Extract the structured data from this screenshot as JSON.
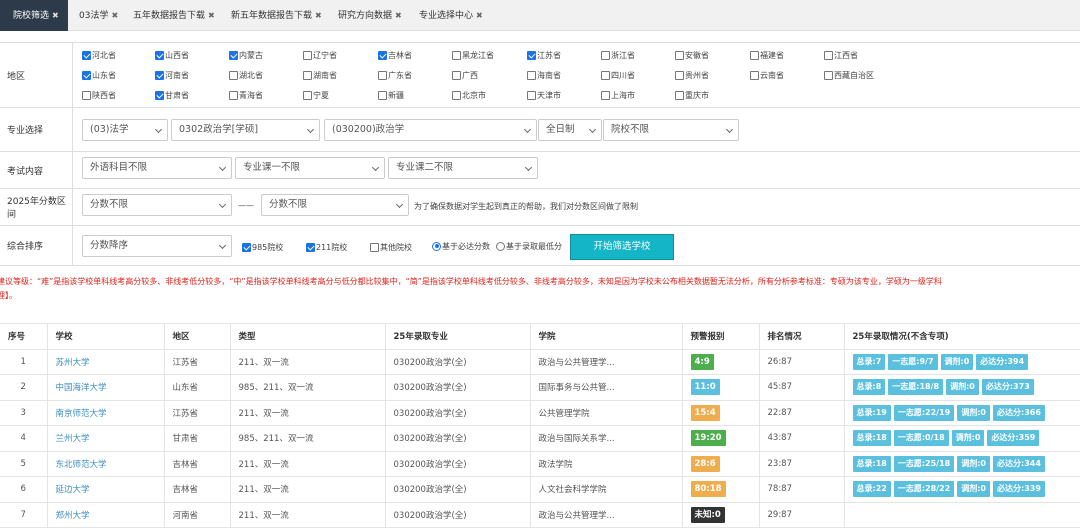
{
  "tabs": [
    {
      "label": "院校筛选",
      "active": true
    },
    {
      "label": "03法学",
      "active": false
    },
    {
      "label": "五年数据报告下载",
      "active": false
    },
    {
      "label": "新五年数据报告下载",
      "active": false
    },
    {
      "label": "研究方向数据",
      "active": false
    },
    {
      "label": "专业选择中心",
      "active": false
    }
  ],
  "region": {
    "label": "地区",
    "provinces": [
      {
        "name": "河北省",
        "checked": true
      },
      {
        "name": "山西省",
        "checked": true
      },
      {
        "name": "内蒙古",
        "checked": true
      },
      {
        "name": "辽宁省",
        "checked": false
      },
      {
        "name": "吉林省",
        "checked": true
      },
      {
        "name": "黑龙江省",
        "checked": false
      },
      {
        "name": "江苏省",
        "checked": true
      },
      {
        "name": "浙江省",
        "checked": false
      },
      {
        "name": "安徽省",
        "checked": false
      },
      {
        "name": "福建省",
        "checked": false
      },
      {
        "name": "江西省",
        "checked": false
      },
      {
        "name": "山东省",
        "checked": true
      },
      {
        "name": "河南省",
        "checked": true
      },
      {
        "name": "湖北省",
        "checked": false
      },
      {
        "name": "湖南省",
        "checked": false
      },
      {
        "name": "广东省",
        "checked": false
      },
      {
        "name": "广西",
        "checked": false
      },
      {
        "name": "海南省",
        "checked": false
      },
      {
        "name": "四川省",
        "checked": false
      },
      {
        "name": "贵州省",
        "checked": false
      },
      {
        "name": "云南省",
        "checked": false
      },
      {
        "name": "西藏自治区",
        "checked": false
      },
      {
        "name": "陕西省",
        "checked": false
      },
      {
        "name": "甘肃省",
        "checked": true
      },
      {
        "name": "青海省",
        "checked": false
      },
      {
        "name": "宁夏",
        "checked": false
      },
      {
        "name": "新疆",
        "checked": false
      },
      {
        "name": "北京市",
        "checked": false
      },
      {
        "name": "天津市",
        "checked": false
      },
      {
        "name": "上海市",
        "checked": false
      },
      {
        "name": "重庆市",
        "checked": false
      }
    ]
  },
  "major": {
    "label": "专业选择",
    "category": "(03)法学",
    "discipline": "0302政治学[学硕]",
    "major": "(030200)政治学",
    "mode": "全日制",
    "school_filter": "院校不限"
  },
  "exam": {
    "label": "考试内容",
    "foreign": "外语科目不限",
    "course1": "专业课一不限",
    "course2": "专业课二不限"
  },
  "score": {
    "label": "2025年分数区间",
    "low": "分数不限",
    "dash": "——",
    "high": "分数不限",
    "note": "为了确保数据对学生起到真正的帮助，我们对分数区间做了限制"
  },
  "sort": {
    "label": "综合排序",
    "order": "分数降序",
    "opt985": "985院校",
    "opt211": "211院校",
    "optOther": "其他院校",
    "radio1": "基于必达分数",
    "radio2": "基于录取最低分",
    "button": "开始筛选学校"
  },
  "advice": {
    "line1": "建议等级：“难”是指该学校单科线考高分较多、非线考低分较多，“中”是指该学校单科线考高分与低分都比较集中，“简”是指该学校单科线考低分较多、非线考高分较多，未知是因为学校未公布相关数据暂无法分析，所有分析参考标准：专硕为该专业，学硕为一级学科",
    "line2": "理】。"
  },
  "table": {
    "headers": [
      "序号",
      "学校",
      "地区",
      "类型",
      "25年录取专业",
      "学院",
      "预警报别",
      "排名情况",
      "25年录取情况(不含专项)"
    ],
    "rows": [
      {
        "idx": "1",
        "school": "苏州大学",
        "region": "江苏省",
        "type": "211、双一流",
        "major": "030200政治学(全)",
        "college": "政治与公共管理学...",
        "warn": "4:9",
        "warnColor": "#4cae4c",
        "rank": "26:87",
        "tags": [
          "总录:7",
          "一志愿:9/7",
          "调剂:0",
          "必达分:394"
        ]
      },
      {
        "idx": "2",
        "school": "中国海洋大学",
        "region": "山东省",
        "type": "985、211、双一流",
        "major": "030200政治学(全)",
        "college": "国际事务与公共管...",
        "warn": "11:0",
        "warnColor": "#5bc0de",
        "rank": "45:87",
        "tags": [
          "总录:8",
          "一志愿:18/8",
          "调剂:0",
          "必达分:373"
        ]
      },
      {
        "idx": "3",
        "school": "南京师范大学",
        "region": "江苏省",
        "type": "211、双一流",
        "major": "030200政治学(全)",
        "college": "公共管理学院",
        "warn": "15:4",
        "warnColor": "#f0ad4e",
        "rank": "22:87",
        "tags": [
          "总录:19",
          "一志愿:22/19",
          "调剂:0",
          "必达分:366"
        ]
      },
      {
        "idx": "4",
        "school": "兰州大学",
        "region": "甘肃省",
        "type": "985、211、双一流",
        "major": "030200政治学(全)",
        "college": "政治与国际关系学...",
        "warn": "19:20",
        "warnColor": "#4cae4c",
        "rank": "43:87",
        "tags": [
          "总录:18",
          "一志愿:0/18",
          "调剂:0",
          "必达分:359"
        ]
      },
      {
        "idx": "5",
        "school": "东北师范大学",
        "region": "吉林省",
        "type": "211、双一流",
        "major": "030200政治学(全)",
        "college": "政法学院",
        "warn": "28:6",
        "warnColor": "#f0ad4e",
        "rank": "23:87",
        "tags": [
          "总录:18",
          "一志愿:25/18",
          "调剂:0",
          "必达分:344"
        ]
      },
      {
        "idx": "6",
        "school": "延边大学",
        "region": "吉林省",
        "type": "211、双一流",
        "major": "030200政治学(全)",
        "college": "人文社会科学学院",
        "warn": "80:18",
        "warnColor": "#f0ad4e",
        "rank": "78:87",
        "tags": [
          "总录:22",
          "一志愿:28/22",
          "调剂:0",
          "必达分:339"
        ]
      },
      {
        "idx": "7",
        "school": "郑州大学",
        "region": "河南省",
        "type": "211、双一流",
        "major": "030200政治学(全)",
        "college": "政治与公共管理学...",
        "warn": "未知:0",
        "warnColor": "#333333",
        "rank": "29:87",
        "tags": []
      }
    ]
  }
}
